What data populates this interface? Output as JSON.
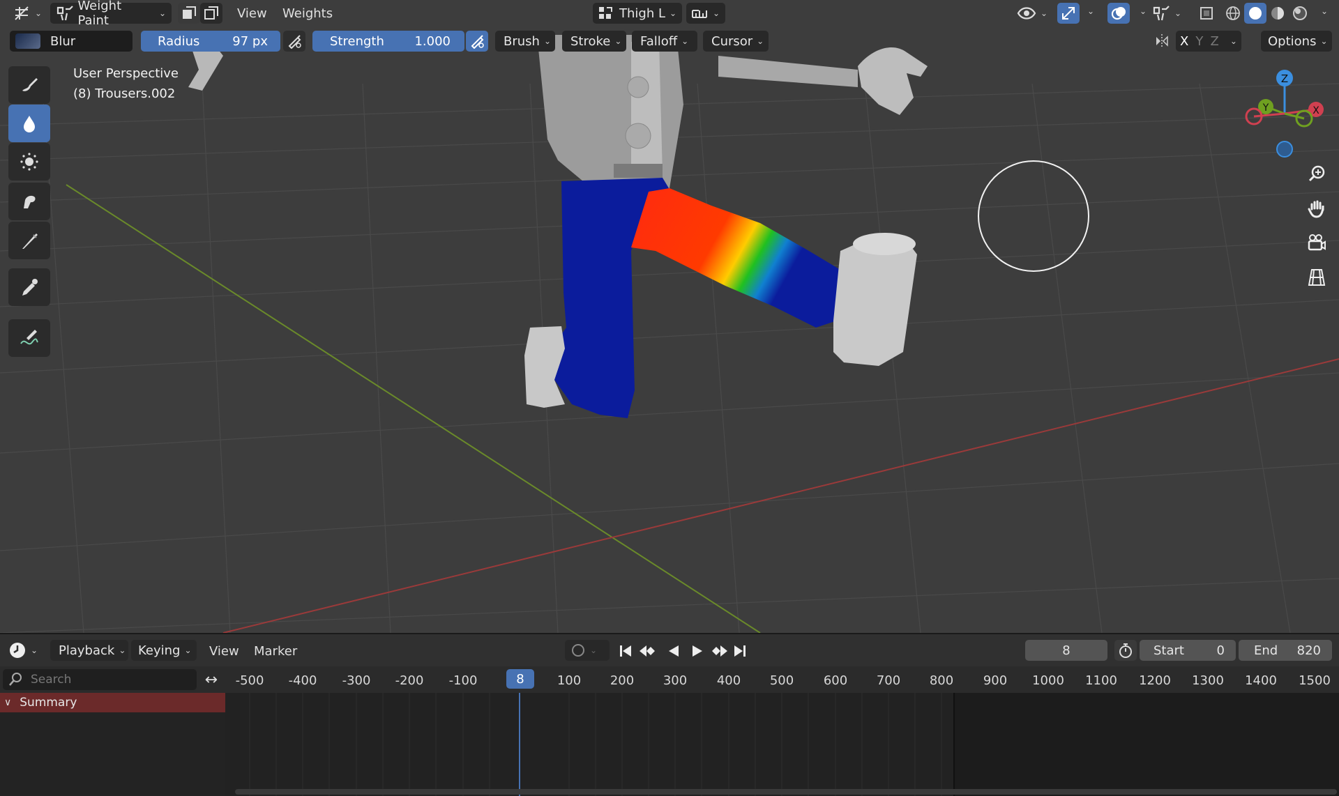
{
  "header": {
    "mode": "Weight Paint",
    "menus": [
      "View",
      "Weights"
    ],
    "vertex_group": "Thigh L",
    "options_label": "Options",
    "axes": [
      "X",
      "Y",
      "Z"
    ]
  },
  "toolbar": {
    "brush_name": "Blur",
    "radius_label": "Radius",
    "radius_value": "97 px",
    "strength_label": "Strength",
    "strength_value": "1.000",
    "dropdowns": [
      "Brush",
      "Stroke",
      "Falloff",
      "Cursor"
    ]
  },
  "viewport": {
    "perspective": "User Perspective",
    "object": "(8) Trousers.002",
    "gizmo_axes": [
      "Z",
      "Y",
      "X"
    ]
  },
  "tools": [
    "draw-brush",
    "blur-brush",
    "average-brush",
    "smear-brush",
    "gradient",
    "sample-weight",
    "annotate"
  ],
  "timeline": {
    "menus": [
      "Playback",
      "Keying",
      "View",
      "Marker"
    ],
    "current_frame": "8",
    "start_label": "Start",
    "start_value": "0",
    "end_label": "End",
    "end_value": "820",
    "search_placeholder": "Search",
    "summary_label": "Summary",
    "ruler_ticks": [
      "-500",
      "-400",
      "-300",
      "-200",
      "-100",
      "100",
      "200",
      "300",
      "400",
      "500",
      "600",
      "700",
      "800",
      "900",
      "1000",
      "1100",
      "1200",
      "1300",
      "1400",
      "1500"
    ]
  },
  "colors": {
    "accent": "#4772b3",
    "background": "#3d3d3d",
    "summary_row": "#6b2a2a",
    "frame_indicator": "#4772b3"
  }
}
